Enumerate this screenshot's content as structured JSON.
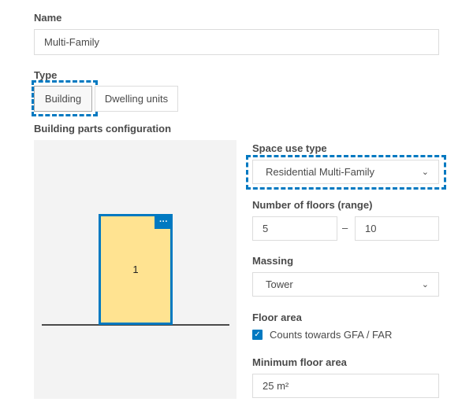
{
  "name": {
    "label": "Name",
    "value": "Multi-Family"
  },
  "type": {
    "label": "Type",
    "options": [
      "Building",
      "Dwelling units"
    ],
    "selected": "Building"
  },
  "config": {
    "label": "Building parts configuration",
    "part_number": "1",
    "menu": "···"
  },
  "space_use": {
    "label": "Space use type",
    "value": "Residential Multi-Family"
  },
  "floors": {
    "label": "Number of floors (range)",
    "min": "5",
    "separator": "–",
    "max": "10"
  },
  "massing": {
    "label": "Massing",
    "value": "Tower"
  },
  "floor_area": {
    "label": "Floor area",
    "checkbox_label": "Counts towards GFA / FAR",
    "checked": true
  },
  "min_floor_area": {
    "label": "Minimum floor area",
    "value": "25 m²"
  },
  "colors": {
    "accent": "#0079c1",
    "building_fill": "#ffe391"
  }
}
